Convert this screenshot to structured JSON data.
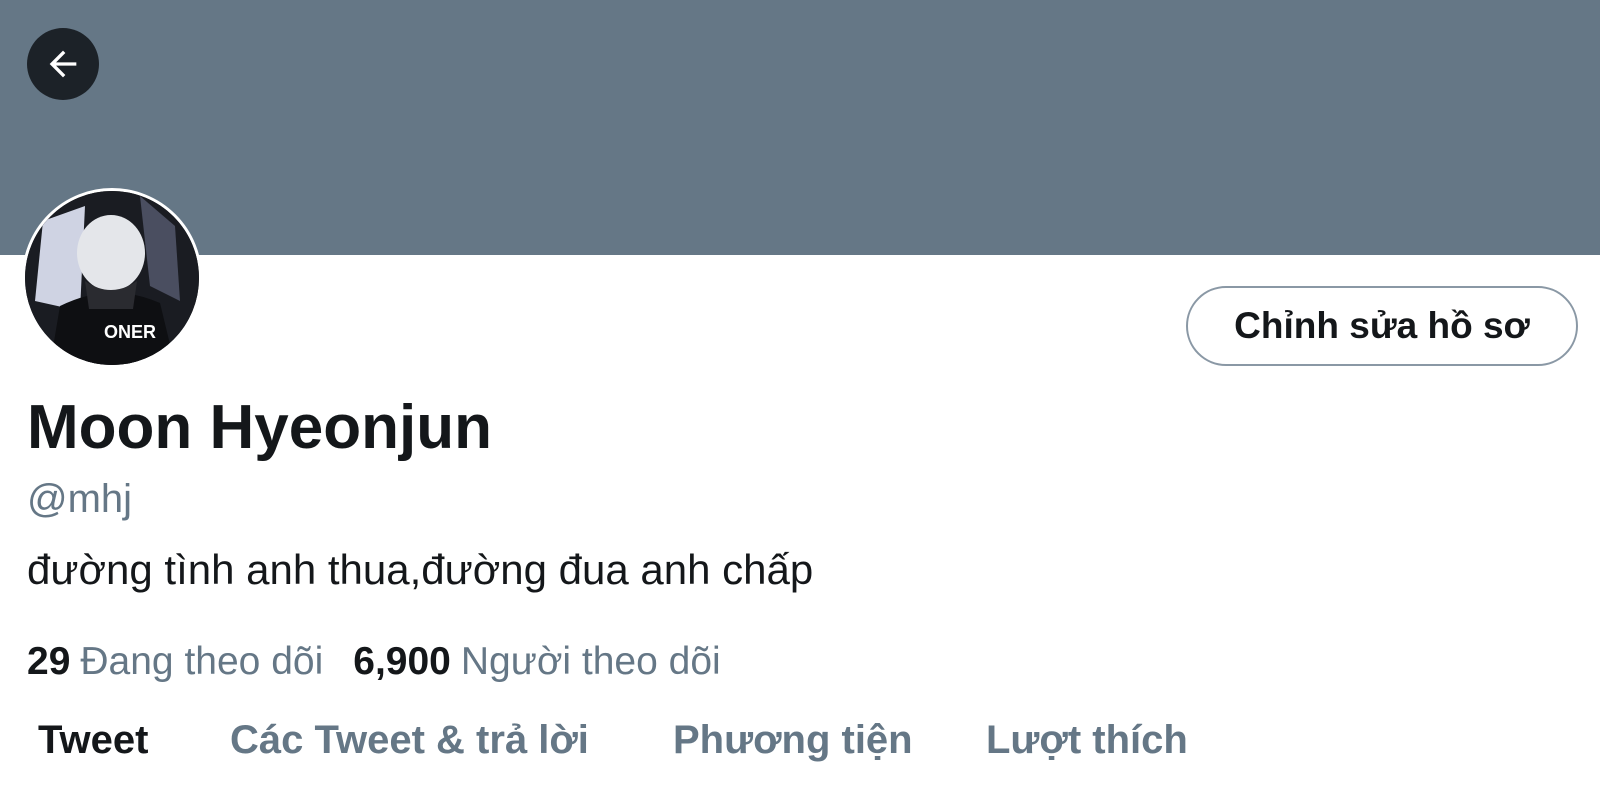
{
  "header": {
    "back_icon": "arrow-left-icon"
  },
  "profile": {
    "avatar_jersey_text": "ONER",
    "edit_button_label": "Chỉnh sửa hồ sơ",
    "display_name": "Moon Hyeonjun",
    "handle": "@mhj",
    "bio": "đường tình anh thua,đường đua anh chấp",
    "following_count": "29",
    "following_label": "Đang theo dõi",
    "followers_count": "6,900",
    "followers_label": "Người theo dõi"
  },
  "tabs": [
    {
      "label": "Tweet",
      "active": true
    },
    {
      "label": "Các Tweet & trả lời",
      "active": false
    },
    {
      "label": "Phương tiện",
      "active": false
    },
    {
      "label": "Lượt thích",
      "active": false
    }
  ],
  "colors": {
    "banner": "#657786",
    "text_primary": "#14171a",
    "text_secondary": "#657786"
  }
}
